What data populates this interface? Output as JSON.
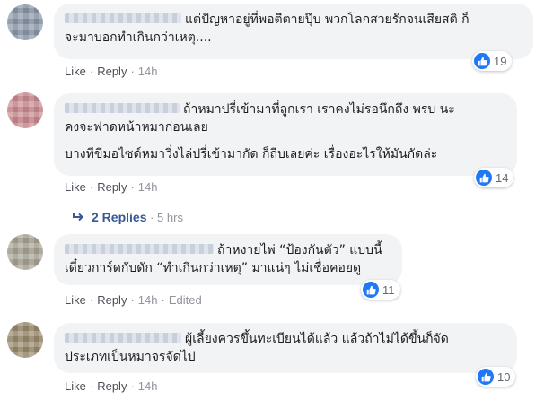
{
  "comments": [
    {
      "text_lines": [
        "แต่ปัญหาอยู่ที่พอตีตายปุ๊บ พวกโลกสวยรักจนเสียสติ ก็",
        "จะมาบอกทำเกินกว่าเหตุ...."
      ],
      "paragraphs": [],
      "actions": {
        "like": "Like",
        "reply": "Reply",
        "time": "14h",
        "edited": ""
      },
      "likes": "19"
    },
    {
      "text_lines": [
        "ถ้าหมาปรี่เข้ามาที่ลูกเรา เราคงไม่รอนึกถึง พรบ นะ",
        "คงจะฟาดหน้าหมาก่อนเลย"
      ],
      "paragraphs": [
        "บางทีขี่มอไซด์หมาวิ่งไล่ปรี่เข้ามากัด ก็ถีบเลยค่ะ เรื่องอะไรให้มันกัดล่ะ"
      ],
      "actions": {
        "like": "Like",
        "reply": "Reply",
        "time": "14h",
        "edited": ""
      },
      "likes": "14",
      "replies": {
        "label": "2 Replies",
        "time": "5 hrs"
      }
    },
    {
      "text_lines": [
        "ถ้าหงายไพ่ “ป้องกันตัว” แบบนี้",
        "เดี๋ยวการ์ดกับดัก “ทำเกินกว่าเหตุ” มาแน่ๆ ไม่เชื่อคอยดู"
      ],
      "paragraphs": [],
      "actions": {
        "like": "Like",
        "reply": "Reply",
        "time": "14h",
        "edited": "Edited"
      },
      "likes": "11"
    },
    {
      "text_lines": [
        "ผู้เลี้ยงควรขึ้นทะเบียนได้แล้ว แล้วถ้าไม่ได้ขึ้นก็จัด",
        "ประเภทเป็นหมาจรจัดไป"
      ],
      "paragraphs": [],
      "actions": {
        "like": "Like",
        "reply": "Reply",
        "time": "14h",
        "edited": ""
      },
      "likes": "10"
    }
  ],
  "colors": {
    "like_blue": "#2078f4",
    "link": "#385898",
    "bubble": "#f2f3f5"
  },
  "icons": {
    "like": "thumbs-up-icon",
    "reply_arrow": "reply-arrow-icon"
  }
}
